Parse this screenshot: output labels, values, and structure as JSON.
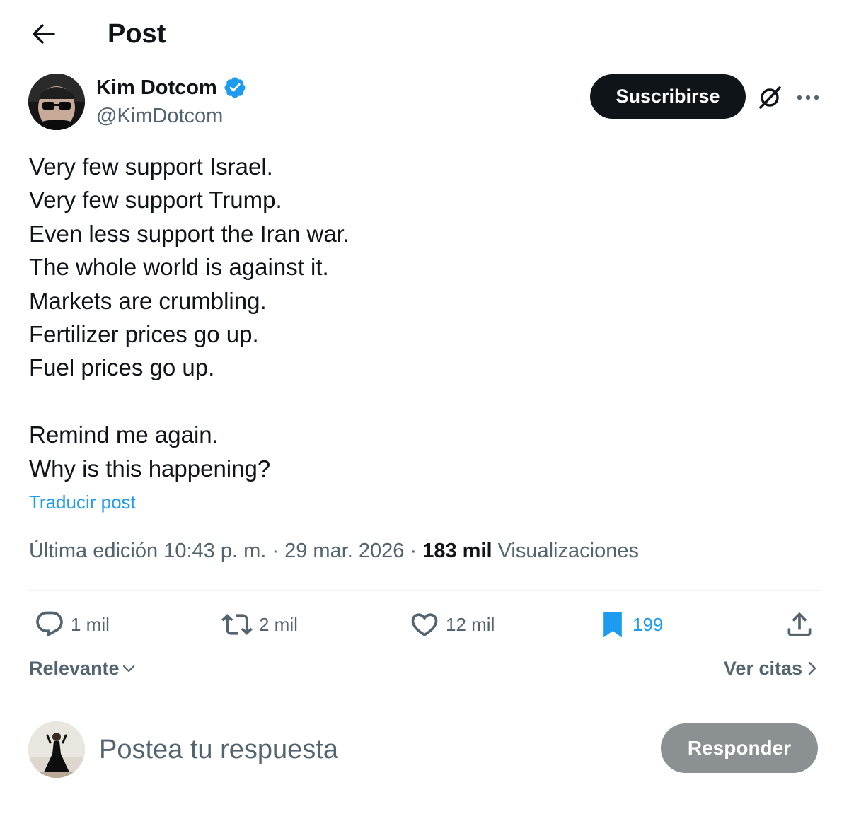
{
  "header": {
    "title": "Post",
    "back_icon": "arrow-left-icon"
  },
  "author": {
    "name": "Kim Dotcom",
    "handle": "@KimDotcom",
    "verified_icon": "verified-badge-icon",
    "verified_color": "#1d9bf0"
  },
  "actions_top": {
    "subscribe_label": "Suscribirse",
    "grok_icon": "grok-icon",
    "more_icon": "more-horizontal-icon"
  },
  "tweet": {
    "lines": [
      "Very few support Israel.",
      "Very few support Trump.",
      "Even less support the Iran war.",
      "The whole world is against it.",
      "Markets are crumbling.",
      "Fertilizer prices go up.",
      "Fuel prices go up.",
      "",
      "Remind me again.",
      "Why is this happening?"
    ],
    "translate_label": "Traducir post"
  },
  "meta": {
    "edited_label": "Última edición",
    "time": "10:43 p. m.",
    "separator": "·",
    "date": "29 mar. 2026",
    "views_count": "183 mil",
    "views_label": "Visualizaciones"
  },
  "engagement": {
    "replies": "1 mil",
    "reposts": "2 mil",
    "likes": "12 mil",
    "bookmarks": "199",
    "accent_color": "#1d9bf0"
  },
  "replies_bar": {
    "sort_label": "Relevante",
    "quotes_label": "Ver citas"
  },
  "composer": {
    "placeholder": "Postea tu respuesta",
    "reply_label": "Responder"
  }
}
